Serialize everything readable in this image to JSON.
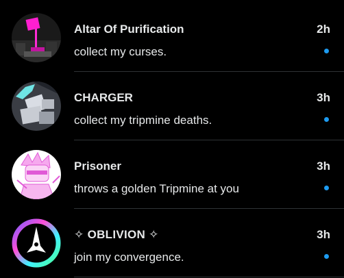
{
  "colors": {
    "unread_dot": "#1d9bf0",
    "divider": "#2f3336",
    "background": "#000000"
  },
  "conversations": [
    {
      "name": "Altar Of Purification",
      "preview": "collect my curses.",
      "time": "2h",
      "unread": true,
      "avatar_icon": "altar-avatar-icon"
    },
    {
      "name": "CHARGER",
      "preview": "collect my tripmine deaths.",
      "time": "3h",
      "unread": true,
      "avatar_icon": "charger-avatar-icon"
    },
    {
      "name": "Prisoner",
      "preview": "throws a golden Tripmine at you",
      "time": "3h",
      "unread": true,
      "avatar_icon": "prisoner-avatar-icon"
    },
    {
      "name": "✧ OBLIVION ✧",
      "preview": "join my convergence.",
      "time": "3h",
      "unread": true,
      "avatar_icon": "oblivion-avatar-icon"
    }
  ]
}
